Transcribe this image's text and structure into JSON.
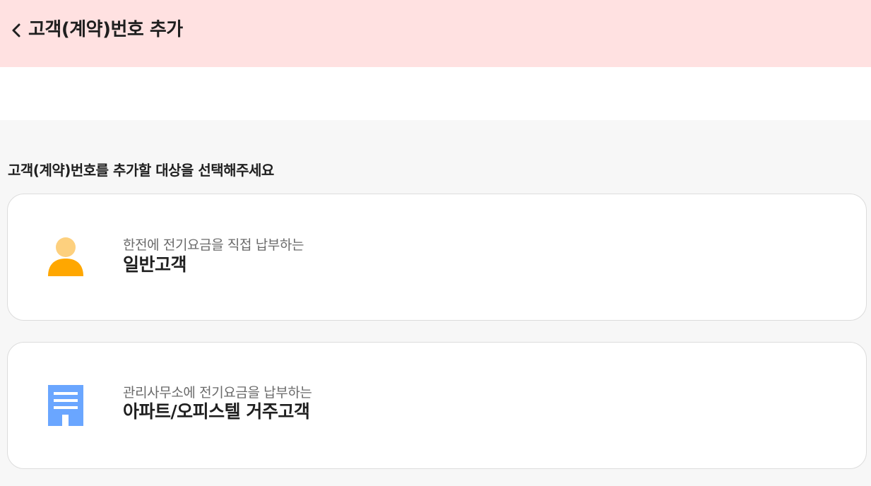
{
  "header": {
    "title": "고객(계약)번호 추가",
    "back_icon": "chevron-left-icon",
    "background": "#ffe1e1"
  },
  "main": {
    "prompt": "고객(계약)번호를 추가할 대상을 선택해주세요",
    "options": [
      {
        "icon": "person-icon",
        "subtitle": "한전에 전기요금을 직접 납부하는",
        "title": "일반고객",
        "icon_colors": [
          "#fdd07e",
          "#ffa700"
        ]
      },
      {
        "icon": "apartment-building-icon",
        "subtitle": "관리사무소에 전기요금을 납부하는",
        "title": "아파트/오피스텔 거주고객",
        "icon_colors": [
          "#6aa6ff",
          "#ffffff"
        ]
      }
    ]
  }
}
